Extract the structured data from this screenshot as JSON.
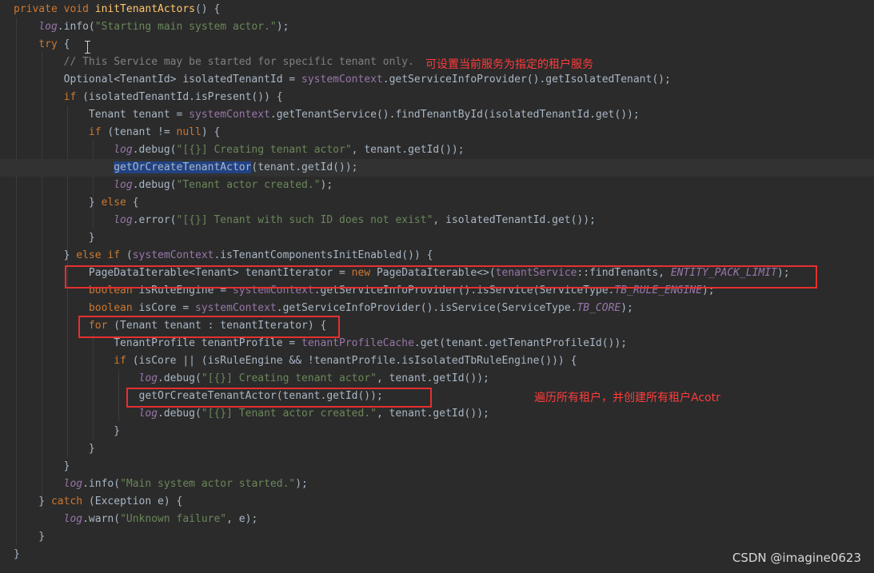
{
  "code": {
    "lines": [
      [
        {
          "t": "private void ",
          "c": "kw"
        },
        {
          "t": "initTenantActors",
          "c": "fn"
        },
        {
          "t": "() {",
          "c": ""
        }
      ],
      [
        {
          "t": "    ",
          "c": ""
        },
        {
          "t": "log",
          "c": "log"
        },
        {
          "t": ".info(",
          "c": ""
        },
        {
          "t": "\"Starting main system actor.\"",
          "c": "str"
        },
        {
          "t": ");",
          "c": ""
        }
      ],
      [
        {
          "t": "    ",
          "c": ""
        },
        {
          "t": "try",
          "c": "kw"
        },
        {
          "t": " {",
          "c": ""
        }
      ],
      [
        {
          "t": "        ",
          "c": ""
        },
        {
          "t": "// This Service may be started for specific tenant only.",
          "c": "cmt"
        }
      ],
      [
        {
          "t": "        Optional<TenantId> isolatedTenantId = ",
          "c": ""
        },
        {
          "t": "systemContext",
          "c": "field"
        },
        {
          "t": ".getServiceInfoProvider().getIsolatedTenant();",
          "c": ""
        }
      ],
      [
        {
          "t": "        ",
          "c": ""
        },
        {
          "t": "if",
          "c": "kw"
        },
        {
          "t": " (isolatedTenantId.isPresent()) {",
          "c": ""
        }
      ],
      [
        {
          "t": "            Tenant tenant = ",
          "c": ""
        },
        {
          "t": "systemContext",
          "c": "field"
        },
        {
          "t": ".getTenantService().findTenantById(isolatedTenantId.get());",
          "c": ""
        }
      ],
      [
        {
          "t": "            ",
          "c": ""
        },
        {
          "t": "if",
          "c": "kw"
        },
        {
          "t": " (tenant != ",
          "c": ""
        },
        {
          "t": "null",
          "c": "kw"
        },
        {
          "t": ") {",
          "c": ""
        }
      ],
      [
        {
          "t": "                ",
          "c": ""
        },
        {
          "t": "log",
          "c": "log"
        },
        {
          "t": ".debug(",
          "c": ""
        },
        {
          "t": "\"[{}] Creating tenant actor\"",
          "c": "str"
        },
        {
          "t": ", tenant.getId());",
          "c": ""
        }
      ],
      [
        {
          "t": "                ",
          "c": ""
        },
        {
          "t": "getOrCreateTenantActor",
          "c": "sel"
        },
        {
          "t": "(tenant.getId());",
          "c": ""
        }
      ],
      [
        {
          "t": "                ",
          "c": ""
        },
        {
          "t": "log",
          "c": "log"
        },
        {
          "t": ".debug(",
          "c": ""
        },
        {
          "t": "\"Tenant actor created.\"",
          "c": "str"
        },
        {
          "t": ");",
          "c": ""
        }
      ],
      [
        {
          "t": "            } ",
          "c": ""
        },
        {
          "t": "else",
          "c": "kw"
        },
        {
          "t": " {",
          "c": ""
        }
      ],
      [
        {
          "t": "                ",
          "c": ""
        },
        {
          "t": "log",
          "c": "log"
        },
        {
          "t": ".error(",
          "c": ""
        },
        {
          "t": "\"[{}] Tenant with such ID does not exist\"",
          "c": "str"
        },
        {
          "t": ", isolatedTenantId.get());",
          "c": ""
        }
      ],
      [
        {
          "t": "            }",
          "c": ""
        }
      ],
      [
        {
          "t": "        } ",
          "c": ""
        },
        {
          "t": "else if",
          "c": "kw"
        },
        {
          "t": " (",
          "c": ""
        },
        {
          "t": "systemContext",
          "c": "field"
        },
        {
          "t": ".isTenantComponentsInitEnabled()) {",
          "c": ""
        }
      ],
      [
        {
          "t": "            PageDataIterable<Tenant> tenantIterator = ",
          "c": ""
        },
        {
          "t": "new",
          "c": "kw"
        },
        {
          "t": " PageDataIterable<>(",
          "c": ""
        },
        {
          "t": "tenantService",
          "c": "field"
        },
        {
          "t": "::findTenants, ",
          "c": ""
        },
        {
          "t": "ENTITY_PACK_LIMIT",
          "c": "const"
        },
        {
          "t": ");",
          "c": ""
        }
      ],
      [
        {
          "t": "            ",
          "c": ""
        },
        {
          "t": "boolean",
          "c": "kw"
        },
        {
          "t": " isRuleEngine = ",
          "c": ""
        },
        {
          "t": "systemContext",
          "c": "field"
        },
        {
          "t": ".getServiceInfoProvider().isService(ServiceType.",
          "c": ""
        },
        {
          "t": "TB_RULE_ENGINE",
          "c": "const"
        },
        {
          "t": ");",
          "c": ""
        }
      ],
      [
        {
          "t": "            ",
          "c": ""
        },
        {
          "t": "boolean",
          "c": "kw"
        },
        {
          "t": " isCore = ",
          "c": ""
        },
        {
          "t": "systemContext",
          "c": "field"
        },
        {
          "t": ".getServiceInfoProvider().isService(ServiceType.",
          "c": ""
        },
        {
          "t": "TB_CORE",
          "c": "const"
        },
        {
          "t": ");",
          "c": ""
        }
      ],
      [
        {
          "t": "            ",
          "c": ""
        },
        {
          "t": "for",
          "c": "kw"
        },
        {
          "t": " (Tenant tenant : tenantIterator) {",
          "c": ""
        }
      ],
      [
        {
          "t": "                TenantProfile tenantProfile = ",
          "c": ""
        },
        {
          "t": "tenantProfileCache",
          "c": "field"
        },
        {
          "t": ".get(tenant.getTenantProfileId());",
          "c": ""
        }
      ],
      [
        {
          "t": "                ",
          "c": ""
        },
        {
          "t": "if",
          "c": "kw"
        },
        {
          "t": " (isCore || (isRuleEngine && !tenantProfile.isIsolatedTbRuleEngine())) {",
          "c": ""
        }
      ],
      [
        {
          "t": "                    ",
          "c": ""
        },
        {
          "t": "log",
          "c": "log"
        },
        {
          "t": ".debug(",
          "c": ""
        },
        {
          "t": "\"[{}] Creating tenant actor\"",
          "c": "str"
        },
        {
          "t": ", tenant.getId());",
          "c": ""
        }
      ],
      [
        {
          "t": "                    getOrCreateTenantActor(tenant.getId());",
          "c": ""
        }
      ],
      [
        {
          "t": "                    ",
          "c": ""
        },
        {
          "t": "log",
          "c": "log"
        },
        {
          "t": ".debug(",
          "c": ""
        },
        {
          "t": "\"[{}] Tenant actor created.\"",
          "c": "str"
        },
        {
          "t": ", tenant.getId());",
          "c": ""
        }
      ],
      [
        {
          "t": "                }",
          "c": ""
        }
      ],
      [
        {
          "t": "            }",
          "c": ""
        }
      ],
      [
        {
          "t": "        }",
          "c": ""
        }
      ],
      [
        {
          "t": "        ",
          "c": ""
        },
        {
          "t": "log",
          "c": "log"
        },
        {
          "t": ".info(",
          "c": ""
        },
        {
          "t": "\"Main system actor started.\"",
          "c": "str"
        },
        {
          "t": ");",
          "c": ""
        }
      ],
      [
        {
          "t": "    } ",
          "c": ""
        },
        {
          "t": "catch",
          "c": "kw"
        },
        {
          "t": " (Exception e) {",
          "c": ""
        }
      ],
      [
        {
          "t": "        ",
          "c": ""
        },
        {
          "t": "log",
          "c": "log"
        },
        {
          "t": ".warn(",
          "c": ""
        },
        {
          "t": "\"Unknown failure\"",
          "c": "str"
        },
        {
          "t": ", e);",
          "c": ""
        }
      ],
      [
        {
          "t": "    }",
          "c": ""
        }
      ],
      [
        {
          "t": "}",
          "c": ""
        }
      ]
    ],
    "highlighted_line": 9
  },
  "annotations": {
    "note_service": "可设置当前服务为指定的租户服务",
    "note_iterate": "遍历所有租户，并创建所有租户Acotr"
  },
  "watermark": "CSDN @imagine0623",
  "colors": {
    "background": "#2b2b2b",
    "text": "#a9b7c6",
    "keyword": "#cc7832",
    "string": "#6a8759",
    "annotation_red": "#e53030"
  },
  "icons": {
    "text_cursor": "ibeam-cursor-icon"
  }
}
